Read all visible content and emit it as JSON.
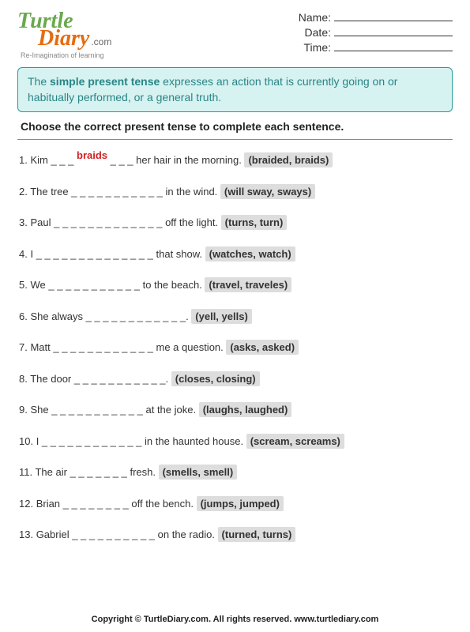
{
  "logo": {
    "word1": "Turtle",
    "word2": "Diary",
    "suffix": ".com",
    "tagline": "Re-Imagination of learning"
  },
  "meta": {
    "name_label": "Name:",
    "date_label": "Date:",
    "time_label": "Time:"
  },
  "info": {
    "prefix": "The ",
    "bold": "simple present tense",
    "rest": " expresses an action that is currently going on or habitually performed, or a general truth."
  },
  "instruction": "Choose the correct present tense to complete each sentence.",
  "questions": [
    {
      "num": "1.",
      "pre": "Kim ",
      "blank": "_ _ _ ",
      "ans": "braids",
      "blank2": " _ _ _ ",
      "post": " her hair in the morning.  ",
      "opts": "(braided, braids)"
    },
    {
      "num": "2.",
      "pre": "The tree ",
      "blank": "_ _ _ _ _ _ _ _ _ _ _",
      "ans": "",
      "blank2": "",
      "post": " in the wind.  ",
      "opts": "(will sway, sways)"
    },
    {
      "num": "3.",
      "pre": "Paul ",
      "blank": "_ _ _ _ _ _ _ _ _ _ _ _ _",
      "ans": "",
      "blank2": "",
      "post": " off the light.  ",
      "opts": "(turns, turn)"
    },
    {
      "num": "4.",
      "pre": "I ",
      "blank": "_ _ _ _ _ _ _ _ _ _ _ _ _ _",
      "ans": "",
      "blank2": "",
      "post": " that show.  ",
      "opts": "(watches, watch)"
    },
    {
      "num": "5.",
      "pre": "We ",
      "blank": "_ _ _ _ _ _ _ _ _ _ _",
      "ans": "",
      "blank2": "",
      "post": " to the beach.  ",
      "opts": "(travel, traveles)"
    },
    {
      "num": "6.",
      "pre": "She always ",
      "blank": "_ _ _ _ _ _ _ _ _ _ _ _",
      "ans": "",
      "blank2": "",
      "post": ".  ",
      "opts": "(yell, yells)"
    },
    {
      "num": "7.",
      "pre": "Matt ",
      "blank": "_ _ _ _ _ _ _ _ _ _ _ _",
      "ans": "",
      "blank2": "",
      "post": " me a question.  ",
      "opts": "(asks, asked)"
    },
    {
      "num": "8.",
      "pre": "The door ",
      "blank": "_ _ _ _ _ _ _ _ _ _ _",
      "ans": "",
      "blank2": "",
      "post": ".  ",
      "opts": "(closes, closing)"
    },
    {
      "num": "9.",
      "pre": "She ",
      "blank": "_ _ _ _ _ _ _ _ _ _ _",
      "ans": "",
      "blank2": "",
      "post": " at the joke.  ",
      "opts": "(laughs, laughed)"
    },
    {
      "num": "10.",
      "pre": "I ",
      "blank": "_ _ _ _ _ _ _ _ _ _ _ _",
      "ans": "",
      "blank2": "",
      "post": " in the haunted house.  ",
      "opts": "(scream, screams)"
    },
    {
      "num": "11.",
      "pre": "The air ",
      "blank": "_ _ _ _ _ _ _",
      "ans": "",
      "blank2": "",
      "post": " fresh.  ",
      "opts": "(smells, smell)"
    },
    {
      "num": "12.",
      "pre": "Brian ",
      "blank": "_ _ _ _ _ _ _ _",
      "ans": "",
      "blank2": "",
      "post": " off the bench.  ",
      "opts": "(jumps, jumped)"
    },
    {
      "num": "13.",
      "pre": "Gabriel ",
      "blank": "_ _ _ _ _ _ _ _ _ _",
      "ans": "",
      "blank2": "",
      "post": " on the radio.  ",
      "opts": "(turned, turns)"
    }
  ],
  "footer": "Copyright © TurtleDiary.com. All rights reserved. www.turtlediary.com"
}
